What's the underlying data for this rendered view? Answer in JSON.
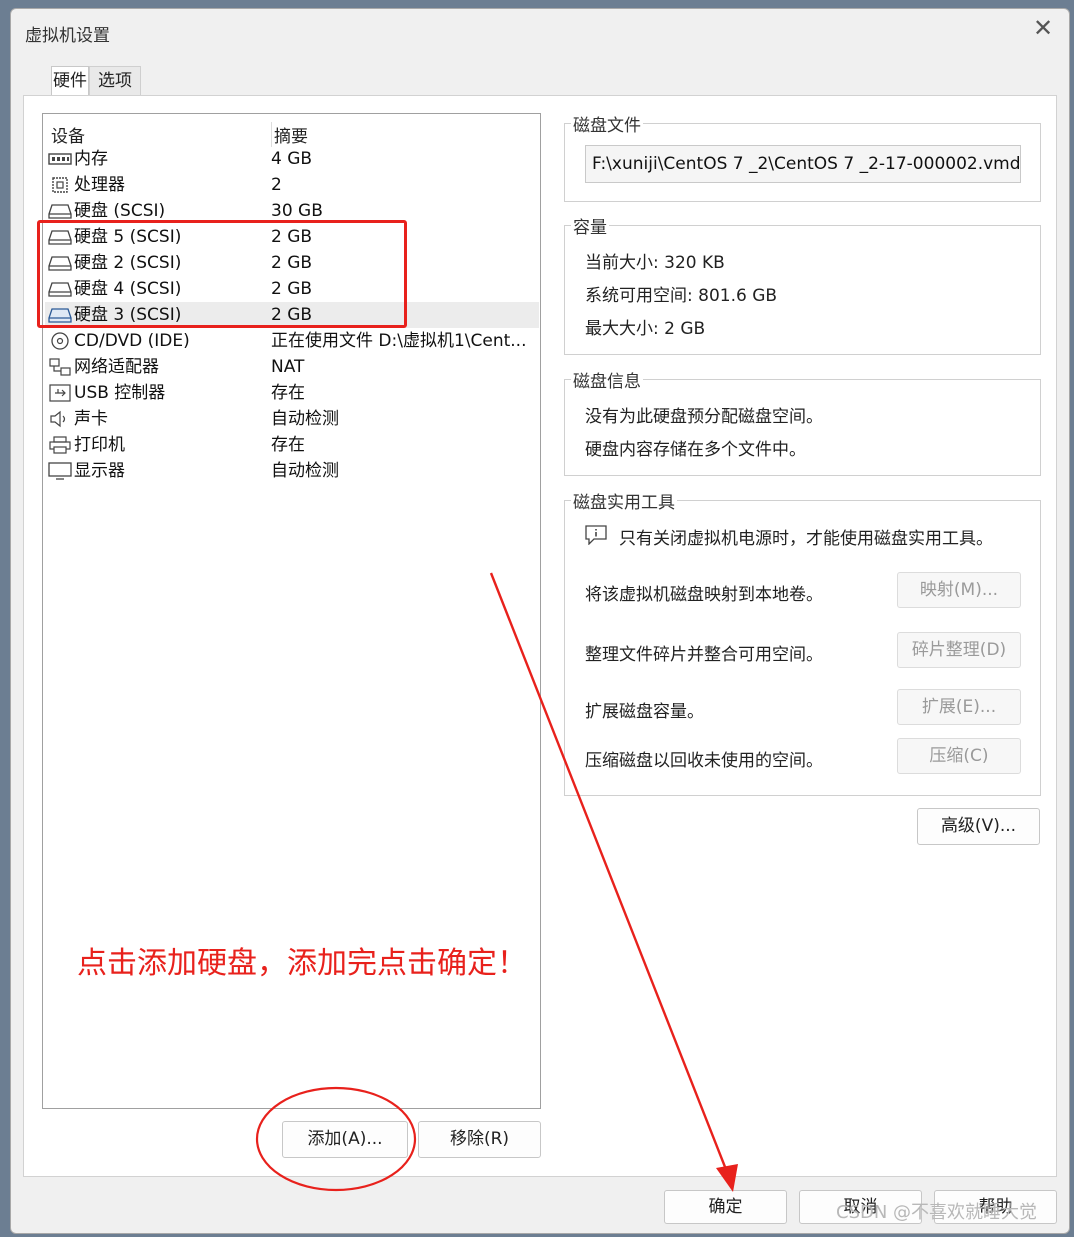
{
  "window": {
    "title": "虚拟机设置"
  },
  "tabs": [
    {
      "label": "硬件"
    },
    {
      "label": "选项"
    }
  ],
  "devices": {
    "col_device": "设备",
    "col_summary": "摘要",
    "rows": [
      {
        "name": "内存",
        "summary": "4 GB",
        "icon": "memory-icon"
      },
      {
        "name": "处理器",
        "summary": "2",
        "icon": "cpu-icon"
      },
      {
        "name": "硬盘 (SCSI)",
        "summary": "30 GB",
        "icon": "hard-disk-icon"
      },
      {
        "name": "硬盘 5 (SCSI)",
        "summary": "2 GB",
        "icon": "hard-disk-icon"
      },
      {
        "name": "硬盘 2 (SCSI)",
        "summary": "2 GB",
        "icon": "hard-disk-icon"
      },
      {
        "name": "硬盘 4 (SCSI)",
        "summary": "2 GB",
        "icon": "hard-disk-icon"
      },
      {
        "name": "硬盘 3 (SCSI)",
        "summary": "2 GB",
        "icon": "hard-disk-icon",
        "selected": true
      },
      {
        "name": "CD/DVD (IDE)",
        "summary": "正在使用文件 D:\\虚拟机1\\Cent...",
        "icon": "cd-dvd-icon"
      },
      {
        "name": "网络适配器",
        "summary": "NAT",
        "icon": "network-adapter-icon"
      },
      {
        "name": "USB 控制器",
        "summary": "存在",
        "icon": "usb-icon"
      },
      {
        "name": "声卡",
        "summary": "自动检测",
        "icon": "speaker-icon"
      },
      {
        "name": "打印机",
        "summary": "存在",
        "icon": "printer-icon"
      },
      {
        "name": "显示器",
        "summary": "自动检测",
        "icon": "monitor-icon"
      }
    ],
    "add_button": "添加(A)...",
    "remove_button": "移除(R)"
  },
  "disk_file": {
    "label": "磁盘文件",
    "value": "F:\\xuniji\\CentOS 7 _2\\CentOS 7 _2-17-000002.vmdk"
  },
  "capacity": {
    "label": "容量",
    "current_label": "当前大小:",
    "current_value": "320 KB",
    "available_label": "系统可用空间:",
    "available_value": "801.6 GB",
    "max_label": "最大大小:",
    "max_value": "2 GB"
  },
  "disk_info": {
    "label": "磁盘信息",
    "line1": "没有为此硬盘预分配磁盘空间。",
    "line2": "硬盘内容存储在多个文件中。"
  },
  "utilities": {
    "label": "磁盘实用工具",
    "notice": "只有关闭虚拟机电源时，才能使用磁盘实用工具。",
    "map_text": "将该虚拟机磁盘映射到本地卷。",
    "map_button": "映射(M)...",
    "defrag_text": "整理文件碎片并整合可用空间。",
    "defrag_button": "碎片整理(D)",
    "expand_text": "扩展磁盘容量。",
    "expand_button": "扩展(E)...",
    "compact_text": "压缩磁盘以回收未使用的空间。",
    "compact_button": "压缩(C)"
  },
  "advanced_button": "高级(V)...",
  "footer": {
    "ok": "确定",
    "cancel": "取消",
    "help": "帮助"
  },
  "annotation": {
    "text": "点击添加硬盘，添加完点击确定！",
    "color": "#e8211c"
  },
  "watermark": "CSDN @不喜欢就睡大觉"
}
